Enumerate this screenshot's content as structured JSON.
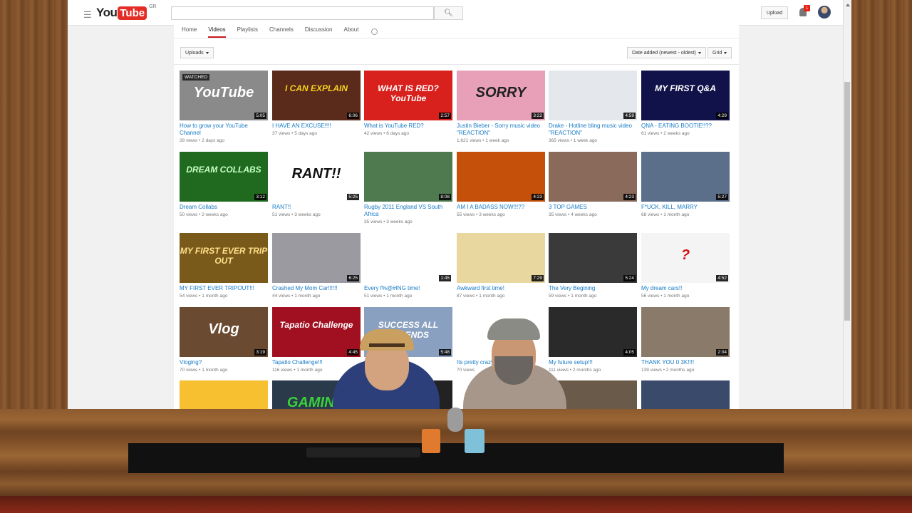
{
  "header": {
    "logo_you": "You",
    "logo_tube": "Tube",
    "logo_region": "GR",
    "search_placeholder": "",
    "upload_label": "Upload",
    "notification_count": "1"
  },
  "channel_tabs": [
    {
      "label": "Home",
      "active": false
    },
    {
      "label": "Videos",
      "active": true
    },
    {
      "label": "Playlists",
      "active": false
    },
    {
      "label": "Channels",
      "active": false
    },
    {
      "label": "Discussion",
      "active": false
    },
    {
      "label": "About",
      "active": false
    }
  ],
  "filters": {
    "uploads_label": "Uploads",
    "sort_label": "Date added (newest - oldest)",
    "view_label": "Grid"
  },
  "watched_label": "WATCHED",
  "videos": [
    {
      "title": "How to grow your YouTube Channel",
      "views": "28 views",
      "age": "2 days ago",
      "duration": "5:05",
      "thumb_text": "YouTube",
      "bg": "#8a8a8a",
      "fg": "#ffffff"
    },
    {
      "title": "I HAVE AN EXCUSE!!!!",
      "views": "37 views",
      "age": "5 days ago",
      "duration": "6:06",
      "thumb_text": "I CAN EXPLAIN",
      "bg": "#5a2a1a",
      "fg": "#f5d020"
    },
    {
      "title": "What is YouTube RED?",
      "views": "42 views",
      "age": "6 days ago",
      "duration": "2:57",
      "thumb_text": "WHAT IS RED? YouTube",
      "bg": "#d8201c",
      "fg": "#ffffff"
    },
    {
      "title": "Justin Bieber - Sorry music video \"REACTION\"",
      "views": "1,621 views",
      "age": "1 week ago",
      "duration": "3:22",
      "thumb_text": "SORRY",
      "bg": "#e8a0b8",
      "fg": "#222222"
    },
    {
      "title": "Drake - Hotline bling music video \"REACTION\"",
      "views": "365 views",
      "age": "1 week ago",
      "duration": "4:59",
      "thumb_text": "",
      "bg": "#e4e8ec",
      "fg": "#cc2222"
    },
    {
      "title": "QNA - EATING BOOTIE!!??",
      "views": "61 views",
      "age": "2 weeks ago",
      "duration": "4:29",
      "thumb_text": "MY FIRST Q&A",
      "bg": "#12124a",
      "fg": "#ffffff"
    },
    {
      "title": "Dream Collabs",
      "views": "50 views",
      "age": "2 weeks ago",
      "duration": "3:12",
      "thumb_text": "DREAM COLLABS",
      "bg": "#1f6a1f",
      "fg": "#c8ffc8"
    },
    {
      "title": "RANT!!",
      "views": "51 views",
      "age": "3 weeks ago",
      "duration": "5:25",
      "thumb_text": "RANT!!",
      "bg": "#ffffff",
      "fg": "#111111"
    },
    {
      "title": "Rugby 2011 England VS South Africa",
      "views": "35 views",
      "age": "3 weeks ago",
      "duration": "8:08",
      "thumb_text": "",
      "bg": "#4f7a4f",
      "fg": "#ffffff"
    },
    {
      "title": "AM I A BADASS NOW!!!??",
      "views": "55 views",
      "age": "3 weeks ago",
      "duration": "4:23",
      "thumb_text": "",
      "bg": "#c4500a",
      "fg": "#111111"
    },
    {
      "title": "3 TOP GAMES",
      "views": "35 views",
      "age": "4 weeks ago",
      "duration": "4:23",
      "thumb_text": "",
      "bg": "#8a6a5a",
      "fg": "#ffffff"
    },
    {
      "title": "F*UCK, KILL, MARRY",
      "views": "68 views",
      "age": "1 month ago",
      "duration": "5:27",
      "thumb_text": "",
      "bg": "#5c6f8a",
      "fg": "#ffffff"
    },
    {
      "title": "MY FIRST EVER TRIPOUT!!!",
      "views": "54 views",
      "age": "1 month ago",
      "duration": "",
      "thumb_text": "MY FIRST EVER TRIP OUT",
      "bg": "#7a5a1a",
      "fg": "#ffe08a"
    },
    {
      "title": "Crashed My Mom Car!!!!!!",
      "views": "44 views",
      "age": "1 month ago",
      "duration": "6:25",
      "thumb_text": "",
      "bg": "#9a9aa0",
      "fg": "#cc1111"
    },
    {
      "title": "Every f%@#ING time!",
      "views": "51 views",
      "age": "1 month ago",
      "duration": "1:45",
      "thumb_text": "",
      "bg": "#ffffff",
      "fg": "#222222"
    },
    {
      "title": "Awkward first time!",
      "views": "87 views",
      "age": "1 month ago",
      "duration": "7:29",
      "thumb_text": "",
      "bg": "#e8d8a0",
      "fg": "#222222"
    },
    {
      "title": "The Very Begining",
      "views": "59 views",
      "age": "1 month ago",
      "duration": "5:24",
      "thumb_text": "",
      "bg": "#3a3a3a",
      "fg": "#ffffff"
    },
    {
      "title": "My dream cars!!",
      "views": "56 views",
      "age": "1 month ago",
      "duration": "4:52",
      "thumb_text": "?",
      "bg": "#f4f4f4",
      "fg": "#cc1111"
    },
    {
      "title": "Vloging?",
      "views": "70 views",
      "age": "1 month ago",
      "duration": "3:19",
      "thumb_text": "Vlog",
      "bg": "#6a4a30",
      "fg": "#ffffff"
    },
    {
      "title": "Tapatio Challenge!!!",
      "views": "116 views",
      "age": "1 month ago",
      "duration": "4:45",
      "thumb_text": "Tapatio Challenge",
      "bg": "#a01020",
      "fg": "#ffffff"
    },
    {
      "title": "Sto",
      "views": "",
      "age": "",
      "duration": "5:48",
      "thumb_text": "SUCCESS ALL DEPENDS",
      "bg": "#8aa0c0",
      "fg": "#ffffff"
    },
    {
      "title": "Its pretty crazy",
      "views": "70 views",
      "age": "",
      "duration": "",
      "thumb_text": "",
      "bg": "#ffffff",
      "fg": "#cc1111"
    },
    {
      "title": "My future setup!!!",
      "views": "111 views",
      "age": "2 months ago",
      "duration": "4:05",
      "thumb_text": "",
      "bg": "#2a2a2a",
      "fg": "#ffffff"
    },
    {
      "title": "THANK YOU 0 3K!!!!",
      "views": "139 views",
      "age": "2 months ago",
      "duration": "2:04",
      "thumb_text": "",
      "bg": "#8a7a6a",
      "fg": "#ffffff"
    },
    {
      "title": "",
      "views": "",
      "age": "",
      "duration": "",
      "thumb_text": "",
      "bg": "#f6c030",
      "fg": "#222222"
    },
    {
      "title": "",
      "views": "",
      "age": "",
      "duration": "",
      "thumb_text": "GAMING",
      "bg": "#2a3a4a",
      "fg": "#3ad03a"
    },
    {
      "title": "",
      "views": "",
      "age": "",
      "duration": "",
      "thumb_text": "",
      "bg": "#222222",
      "fg": "#ffffff"
    },
    {
      "title": "",
      "views": "",
      "age": "",
      "duration": "",
      "thumb_text": "",
      "bg": "#ffffff",
      "fg": "#222222"
    },
    {
      "title": "",
      "views": "",
      "age": "",
      "duration": "",
      "thumb_text": "",
      "bg": "#6a5a4a",
      "fg": "#ffffff"
    },
    {
      "title": "",
      "views": "",
      "age": "",
      "duration": "",
      "thumb_text": "",
      "bg": "#3a4a6a",
      "fg": "#ffffff"
    }
  ]
}
